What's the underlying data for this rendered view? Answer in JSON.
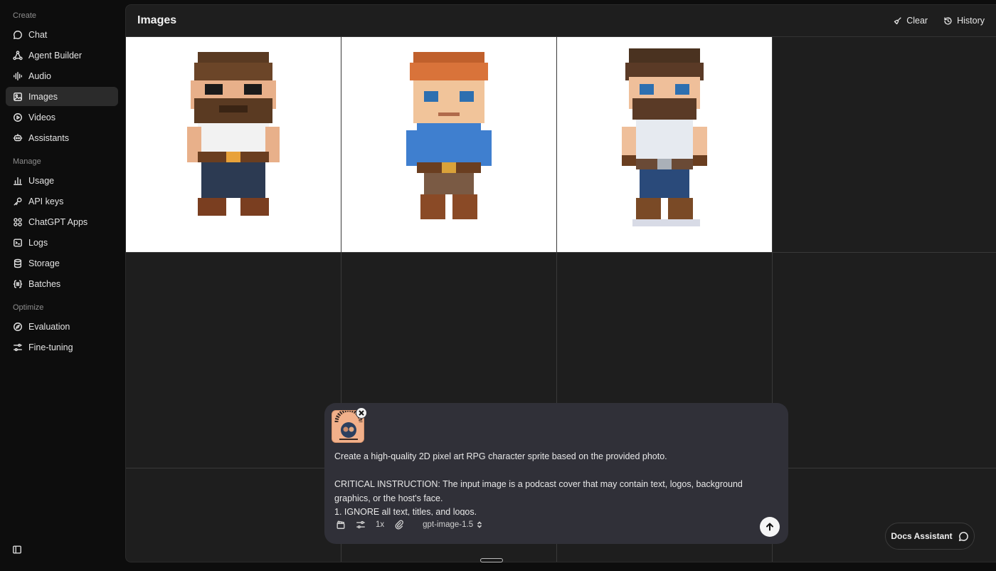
{
  "sidebar": {
    "sections": [
      {
        "label": "Create",
        "items": [
          {
            "label": "Chat",
            "icon": "chat-bubble-icon"
          },
          {
            "label": "Agent Builder",
            "icon": "agent-nodes-icon"
          },
          {
            "label": "Audio",
            "icon": "audio-wave-icon"
          },
          {
            "label": "Images",
            "icon": "image-icon",
            "active": true
          },
          {
            "label": "Videos",
            "icon": "play-icon"
          },
          {
            "label": "Assistants",
            "icon": "robot-icon"
          }
        ]
      },
      {
        "label": "Manage",
        "items": [
          {
            "label": "Usage",
            "icon": "bar-chart-icon"
          },
          {
            "label": "API keys",
            "icon": "key-icon"
          },
          {
            "label": "ChatGPT Apps",
            "icon": "apps-icon"
          },
          {
            "label": "Logs",
            "icon": "terminal-icon"
          },
          {
            "label": "Storage",
            "icon": "database-icon"
          },
          {
            "label": "Batches",
            "icon": "batches-icon"
          }
        ]
      },
      {
        "label": "Optimize",
        "items": [
          {
            "label": "Evaluation",
            "icon": "compass-icon"
          },
          {
            "label": "Fine-tuning",
            "icon": "sliders-icon"
          }
        ]
      }
    ]
  },
  "header": {
    "title": "Images",
    "clear_label": "Clear",
    "history_label": "History"
  },
  "composer": {
    "prompt": "Create a high-quality 2D pixel art RPG character sprite based on the provided photo.\n\nCRITICAL INSTRUCTION: The input image is a podcast cover that may contain text, logos, background graphics, or the host's face.\n1. IGNORE all text, titles, and logos.",
    "count_label": "1x",
    "model": "gpt-image-1.5"
  },
  "docs_assistant": {
    "label": "Docs Assistant"
  },
  "colors": {
    "accent_bg": "#1e1e1e",
    "composer_bg": "#303038",
    "active_nav_bg": "#2b2b2b"
  }
}
